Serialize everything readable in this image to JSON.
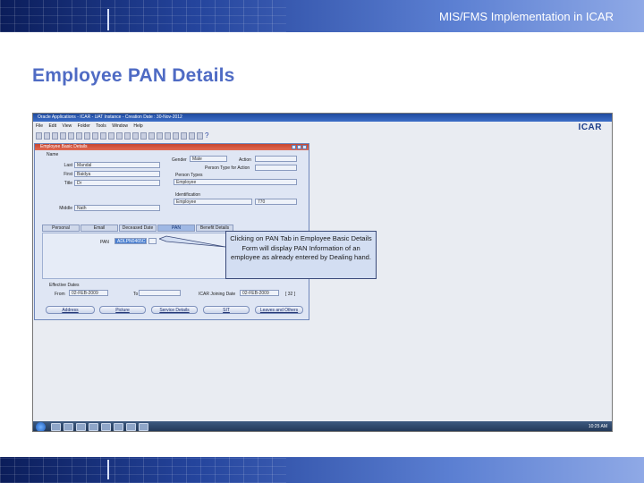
{
  "header": {
    "title": "MIS/FMS Implementation in ICAR"
  },
  "slide": {
    "heading": "Employee PAN Details"
  },
  "app": {
    "window_title": "Oracle Applications - ICAR - UAT Instance - Creation Date : 30-Nov-2012",
    "menu": [
      "File",
      "Edit",
      "View",
      "Folder",
      "Tools",
      "Window",
      "Help"
    ],
    "logo": "ICAR",
    "form_title": "Employee Basic Details",
    "name_section": "Name",
    "labels": {
      "last": "Last",
      "first": "First",
      "title": "Title",
      "middle": "Middle",
      "gender": "Gender",
      "action": "Action",
      "person_type_for_action": "Person Type for Action",
      "person_types": "Person Types",
      "identification": "Identification",
      "pan": "PAN",
      "effective_dates": "Effective Dates",
      "from": "From",
      "to": "To",
      "icar_joining_date": "ICAR Joining Date"
    },
    "values": {
      "last": "Mandal",
      "first": "Baidya",
      "title": "Dr",
      "middle": "Nath",
      "gender": "Male",
      "action": "",
      "person_type_for_action": "",
      "person_type": "Employee",
      "identification": "Employee",
      "id_number": "770",
      "pan": "ADLPN0465C",
      "pan_extra": "",
      "from": "02-FEB-2009",
      "to": "",
      "joining_date": "02-FEB-2009",
      "joining_extra": "[ 32 ]"
    },
    "tabs": [
      "Personal",
      "Email",
      "Deceased Date",
      "PAN",
      "Benefit Details"
    ],
    "active_tab": "PAN",
    "buttons": [
      "Address",
      "Picture",
      "Service Details",
      "SIT",
      "Leaves and Others"
    ],
    "taskbar_time": "10:25 AM"
  },
  "callout": {
    "text": "Clicking on PAN Tab in Employee Basic Details Form will display PAN Information of an employee as already entered by Dealing hand."
  },
  "colors": {
    "heading": "#4f6bc4",
    "banner_dark": "#0b1d5a",
    "banner_light": "#8fa9e6",
    "callout_bg": "#d3def2"
  }
}
